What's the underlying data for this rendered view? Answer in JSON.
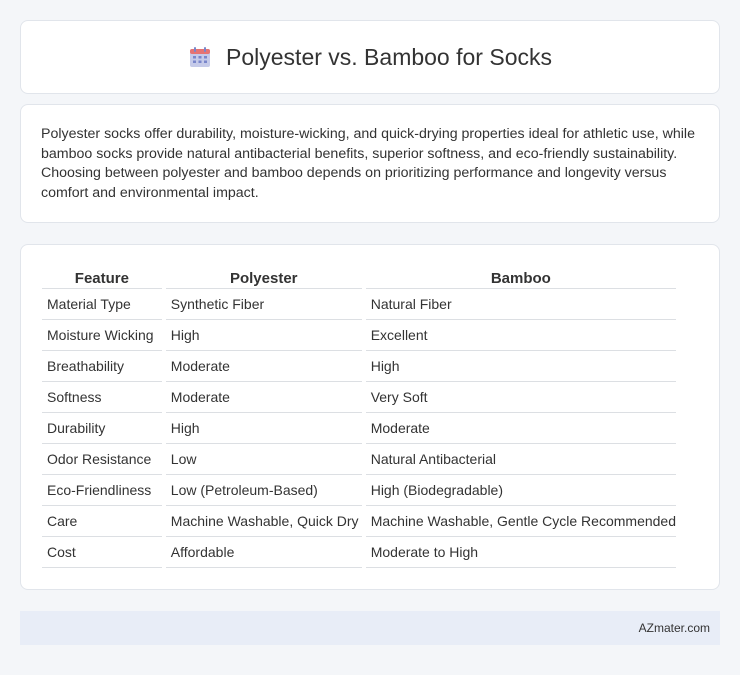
{
  "header": {
    "title": "Polyester vs. Bamboo for Socks",
    "icon": "calendar-icon",
    "icon_colors": {
      "top": "#e57373",
      "body": "#9fa8f0",
      "grid": "#7986cb"
    }
  },
  "summary": {
    "text": "Polyester socks offer durability, moisture-wicking, and quick-drying properties ideal for athletic use, while bamboo socks provide natural antibacterial benefits, superior softness, and eco-friendly sustainability. Choosing between polyester and bamboo depends on prioritizing performance and longevity versus comfort and environmental impact."
  },
  "table": {
    "headers": [
      "Feature",
      "Polyester",
      "Bamboo"
    ],
    "rows": [
      [
        "Material Type",
        "Synthetic Fiber",
        "Natural Fiber"
      ],
      [
        "Moisture Wicking",
        "High",
        "Excellent"
      ],
      [
        "Breathability",
        "Moderate",
        "High"
      ],
      [
        "Softness",
        "Moderate",
        "Very Soft"
      ],
      [
        "Durability",
        "High",
        "Moderate"
      ],
      [
        "Odor Resistance",
        "Low",
        "Natural Antibacterial"
      ],
      [
        "Eco-Friendliness",
        "Low (Petroleum-Based)",
        "High (Biodegradable)"
      ],
      [
        "Care",
        "Machine Washable, Quick Dry",
        "Machine Washable, Gentle Cycle Recommended"
      ],
      [
        "Cost",
        "Affordable",
        "Moderate to High"
      ]
    ]
  },
  "footer": {
    "site": "AZmater.com"
  }
}
